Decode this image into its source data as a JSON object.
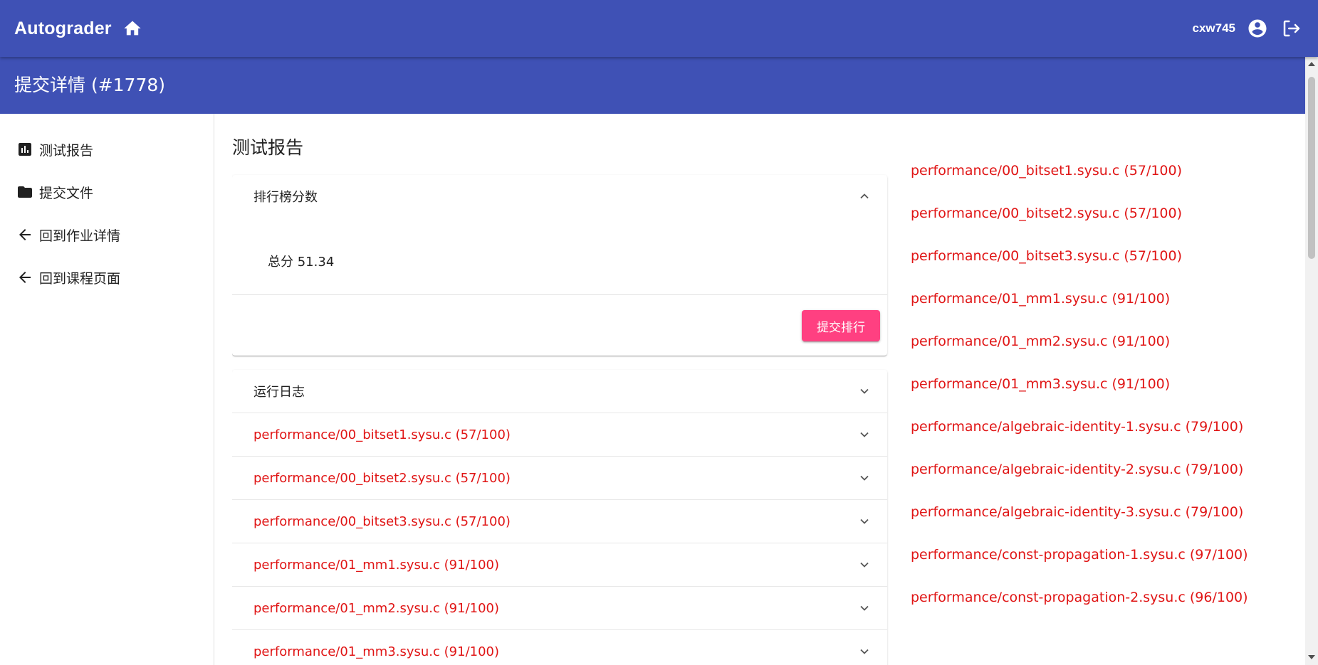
{
  "appbar": {
    "title": "Autograder",
    "username": "cxw745",
    "color": "#3f51b5"
  },
  "subbar": {
    "title": "提交详情 (#1778)"
  },
  "sidebar": {
    "items": [
      {
        "label": "测试报告",
        "icon": "bar-chart-icon"
      },
      {
        "label": "提交文件",
        "icon": "folder-icon"
      },
      {
        "label": "回到作业详情",
        "icon": "arrow-left-icon"
      },
      {
        "label": "回到课程页面",
        "icon": "arrow-left-icon"
      }
    ]
  },
  "main": {
    "title": "测试报告",
    "rank_panel": {
      "header": "排行榜分数",
      "score_label": "总分",
      "score_value": "51.34",
      "submit_label": "提交排行",
      "button_color": "#ff4081"
    },
    "log_panel": {
      "header": "运行日志",
      "items": [
        "performance/00_bitset1.sysu.c (57/100)",
        "performance/00_bitset2.sysu.c (57/100)",
        "performance/00_bitset3.sysu.c (57/100)",
        "performance/01_mm1.sysu.c (91/100)",
        "performance/01_mm2.sysu.c (91/100)",
        "performance/01_mm3.sysu.c (91/100)"
      ]
    },
    "right_list": [
      "performance/00_bitset1.sysu.c (57/100)",
      "performance/00_bitset2.sysu.c (57/100)",
      "performance/00_bitset3.sysu.c (57/100)",
      "performance/01_mm1.sysu.c (91/100)",
      "performance/01_mm2.sysu.c (91/100)",
      "performance/01_mm3.sysu.c (91/100)",
      "performance/algebraic-identity-1.sysu.c (79/100)",
      "performance/algebraic-identity-2.sysu.c (79/100)",
      "performance/algebraic-identity-3.sysu.c (79/100)",
      "performance/const-propagation-1.sysu.c (97/100)",
      "performance/const-propagation-2.sysu.c (96/100)"
    ],
    "error_color": "#e01515"
  }
}
